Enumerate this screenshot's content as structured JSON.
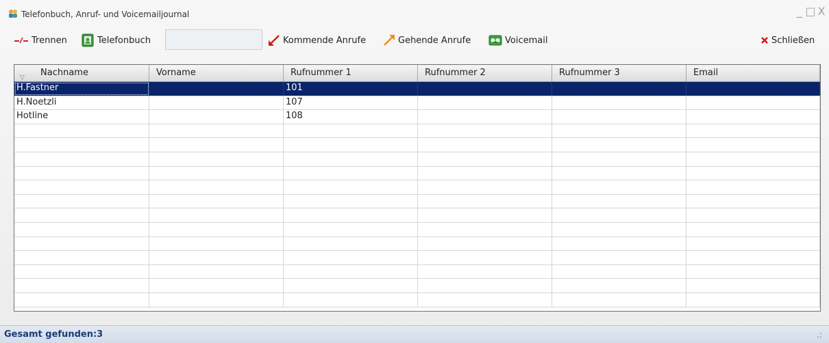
{
  "window": {
    "title": "Telefonbuch, Anruf- und Voicemailjournal",
    "min_glyph": "_",
    "max_glyph": "□",
    "close_glyph": "X"
  },
  "toolbar": {
    "trennen_label": "Trennen",
    "telefonbuch_label": "Telefonbuch",
    "search_value": "",
    "kommende_label": "Kommende Anrufe",
    "gehende_label": "Gehende Anrufe",
    "voicemail_label": "Voicemail",
    "schliessen_label": "Schließen"
  },
  "grid": {
    "columns": [
      "Nachname",
      "Vorname",
      "Rufnummer 1",
      "Rufnummer 2",
      "Rufnummer 3",
      "Email"
    ],
    "rows": [
      [
        "H.Fastner",
        "",
        "101",
        "",
        "",
        ""
      ],
      [
        "H.Noetzli",
        "",
        "107",
        "",
        "",
        ""
      ],
      [
        "Hotline",
        "",
        "108",
        "",
        "",
        ""
      ]
    ],
    "selected_row": 0,
    "empty_rows": 13
  },
  "status": {
    "text": "Gesamt gefunden:3",
    "grip": ".:"
  },
  "colors": {
    "selection": "#0a246a",
    "status_text": "#1a3a7a",
    "close_red": "#d11b1b"
  }
}
